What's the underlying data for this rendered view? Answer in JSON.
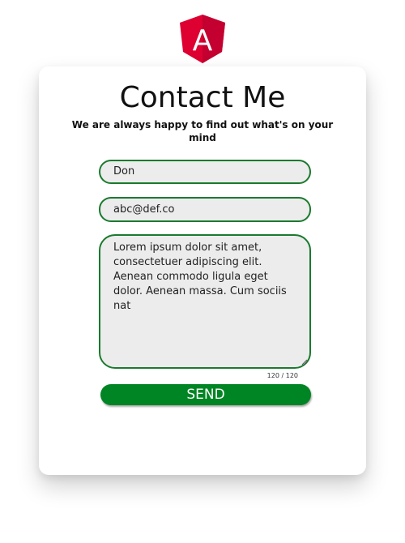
{
  "logo": {
    "icon": "angular-logo-icon",
    "letter": "A",
    "color": "#dd0031"
  },
  "form": {
    "title": "Contact Me",
    "subtitle": "We are always happy to find out what's on your mind",
    "name_value": "Don",
    "email_value": "abc@def.co",
    "message_value": "Lorem ipsum dolor sit amet, consectetuer adipiscing elit. Aenean commodo ligula eget dolor. Aenean massa. Cum sociis nat",
    "counter": "120 / 120",
    "send_label": "SEND"
  },
  "colors": {
    "accent": "#008524",
    "field_border": "#1a7a2e",
    "field_background": "#ececec"
  }
}
